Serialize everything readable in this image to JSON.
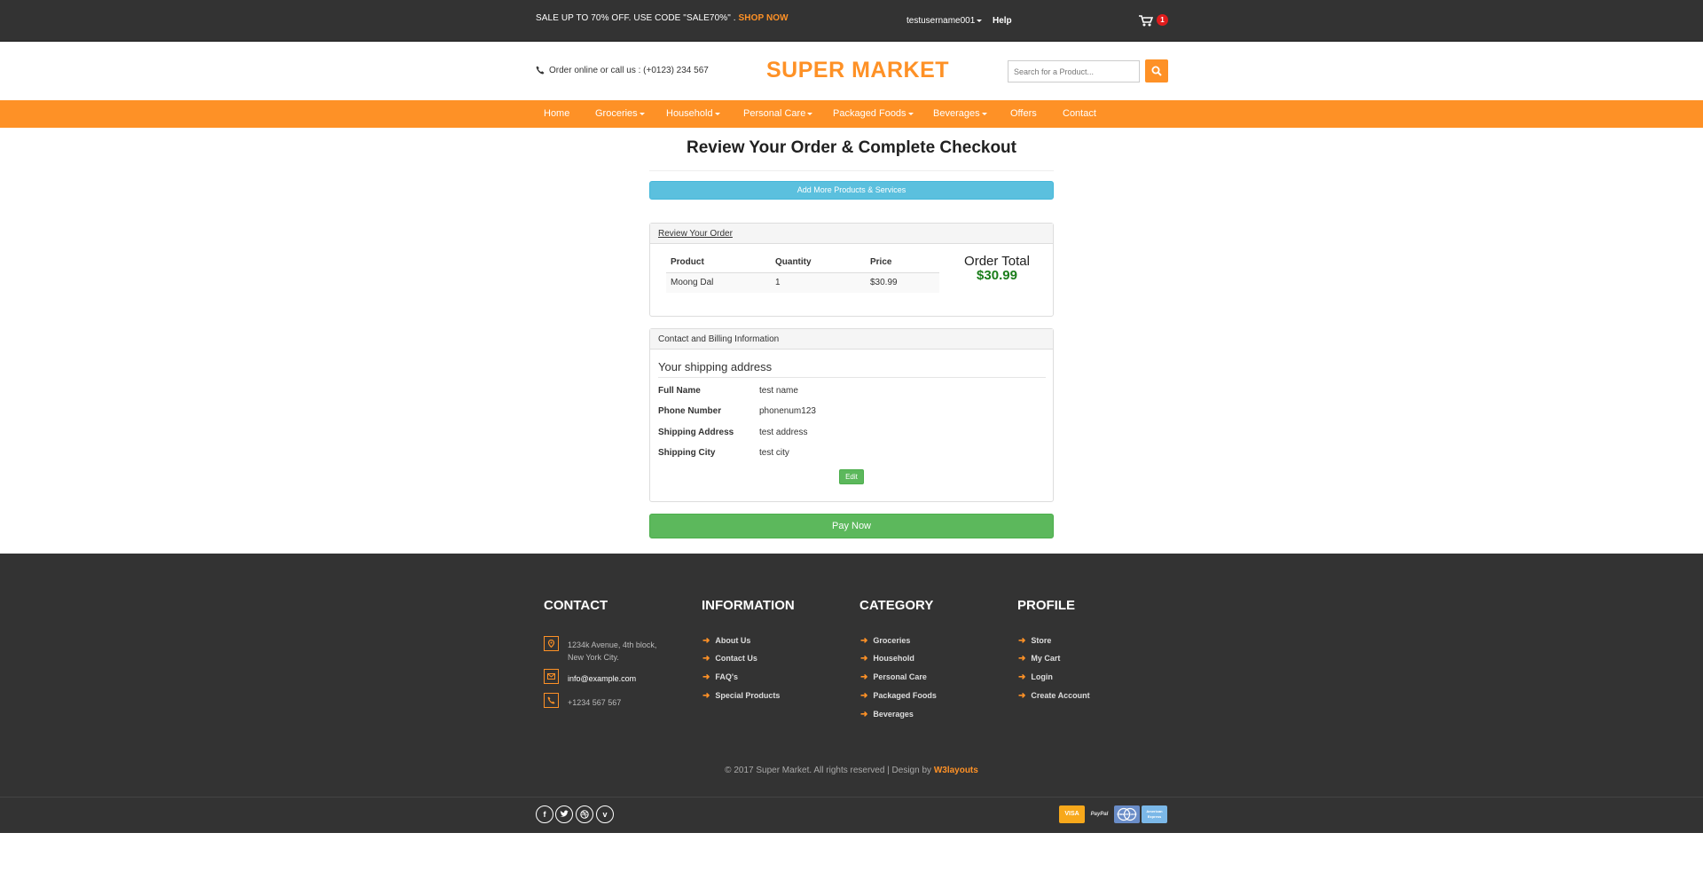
{
  "topbar": {
    "promo_text": "SALE UP TO 70% OFF. USE CODE \"SALE70%\" .",
    "promo_link": "SHOP NOW",
    "username": "testusername001",
    "help": "Help",
    "cart_count": "1"
  },
  "header": {
    "phone_text": "Order online or call us : (+0123) 234 567",
    "brand": "SUPER MARKET",
    "search_placeholder": "Search for a Product..."
  },
  "nav": {
    "home": "Home",
    "groceries": "Groceries",
    "household": "Household",
    "personal_care": "Personal Care",
    "packaged_foods": "Packaged Foods",
    "beverages": "Beverages",
    "offers": "Offers",
    "contact": "Contact"
  },
  "checkout": {
    "title": "Review Your Order & Complete Checkout",
    "add_more": "Add More Products & Services",
    "review_heading": "Review Your Order",
    "columns": [
      "Product",
      "Quantity",
      "Price"
    ],
    "items": [
      {
        "product": "Moong Dal",
        "quantity": "1",
        "price": "$30.99"
      }
    ],
    "order_total_label": "Order Total",
    "order_total_value": "$30.99",
    "billing_heading": "Contact and Billing Information",
    "shipping_heading": "Your shipping address",
    "fields": [
      {
        "label": "Full Name",
        "value": "test name"
      },
      {
        "label": "Phone Number",
        "value": "phonenum123"
      },
      {
        "label": "Shipping Address",
        "value": "test address"
      },
      {
        "label": "Shipping City",
        "value": "test city"
      }
    ],
    "edit": "Edit",
    "pay_now": "Pay Now"
  },
  "footer": {
    "contact_title": "CONTACT",
    "address_line1": "1234k Avenue, 4th block,",
    "address_line2": "New York City.",
    "email": "info@example.com",
    "phone": "+1234 567 567",
    "information_title": "INFORMATION",
    "information_links": [
      "About Us",
      "Contact Us",
      "FAQ's",
      "Special Products"
    ],
    "category_title": "CATEGORY",
    "category_links": [
      "Groceries",
      "Household",
      "Personal Care",
      "Packaged Foods",
      "Beverages"
    ],
    "profile_title": "PROFILE",
    "profile_links": [
      "Store",
      "My Cart",
      "Login",
      "Create Account"
    ],
    "copyright": "© 2017 Super Market. All rights reserved | Design by",
    "designer": "W3layouts",
    "payments": [
      "VISA",
      "PayPal",
      "MasterCard",
      "American Express"
    ]
  },
  "colors": {
    "accent": "#fe9126",
    "dark": "#333333",
    "info_button": "#5bc0de",
    "success": "#5cb85c",
    "total_green": "#1a7d1a"
  }
}
